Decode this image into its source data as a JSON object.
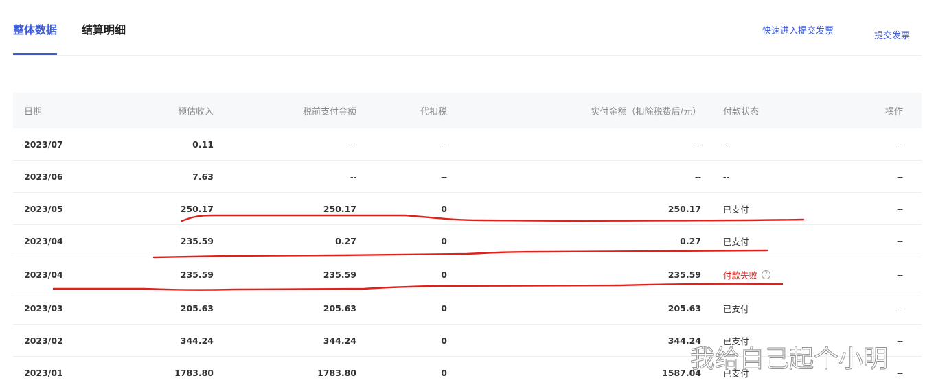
{
  "tabs": [
    {
      "label": "整体数据"
    },
    {
      "label": "结算明细"
    }
  ],
  "links": {
    "quick_invoice": "快速进入提交发票",
    "submit_invoice": "提交发票"
  },
  "table": {
    "headers": {
      "date": "日期",
      "estimated_income": "预估收入",
      "pre_tax_amount": "税前支付金额",
      "withheld_tax": "代扣税",
      "actual_amount": "实付金额（扣除税费后/元）",
      "status": "付款状态",
      "action": "操作"
    },
    "rows": [
      {
        "date": "2023/07",
        "estimated_income": "0.11",
        "pre_tax_amount": "--",
        "withheld_tax": "--",
        "actual_amount": "--",
        "status": "--",
        "action": "--"
      },
      {
        "date": "2023/06",
        "estimated_income": "7.63",
        "pre_tax_amount": "--",
        "withheld_tax": "--",
        "actual_amount": "--",
        "status": "--",
        "action": "--"
      },
      {
        "date": "2023/05",
        "estimated_income": "250.17",
        "pre_tax_amount": "250.17",
        "withheld_tax": "0",
        "actual_amount": "250.17",
        "status": "已支付",
        "action": "--"
      },
      {
        "date": "2023/04",
        "estimated_income": "235.59",
        "pre_tax_amount": "0.27",
        "withheld_tax": "0",
        "actual_amount": "0.27",
        "status": "已支付",
        "action": "--"
      },
      {
        "date": "2023/04",
        "estimated_income": "235.59",
        "pre_tax_amount": "235.59",
        "withheld_tax": "0",
        "actual_amount": "235.59",
        "status": "付款失败",
        "action": "--"
      },
      {
        "date": "2023/03",
        "estimated_income": "205.63",
        "pre_tax_amount": "205.63",
        "withheld_tax": "0",
        "actual_amount": "205.63",
        "status": "已支付",
        "action": "--"
      },
      {
        "date": "2023/02",
        "estimated_income": "344.24",
        "pre_tax_amount": "344.24",
        "withheld_tax": "0",
        "actual_amount": "344.24",
        "status": "已支付",
        "action": "--"
      },
      {
        "date": "2023/01",
        "estimated_income": "1783.80",
        "pre_tax_amount": "1783.80",
        "withheld_tax": "0",
        "actual_amount": "1587.04",
        "status": "已支付",
        "action": "--"
      }
    ]
  },
  "help_icon": {
    "glyph": "?",
    "icon": "question-circle-icon"
  },
  "watermark": {
    "text": "我给自己起个小明"
  },
  "colors": {
    "accent": "#3c5bd6",
    "fail": "#d9241d",
    "annotation": "#e0201a"
  }
}
